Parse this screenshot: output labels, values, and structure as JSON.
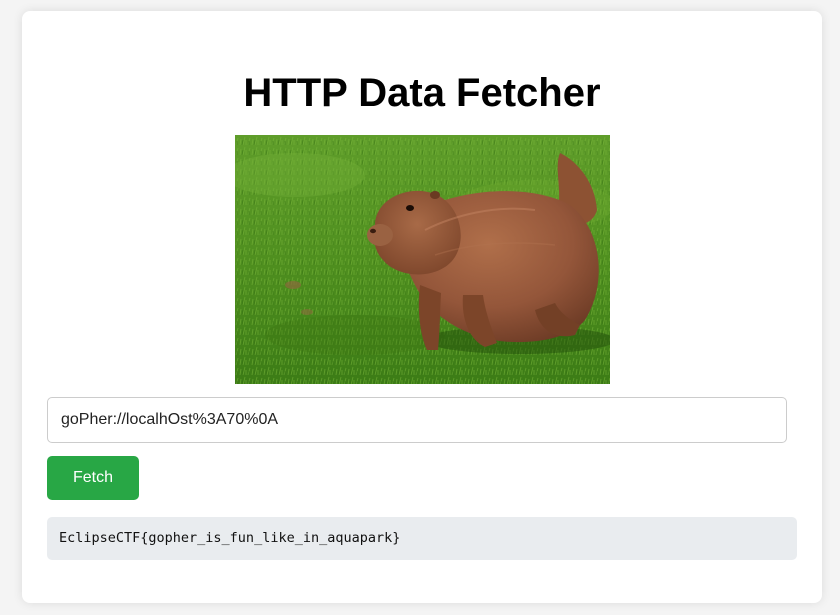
{
  "page": {
    "title": "HTTP Data Fetcher"
  },
  "hero_image": {
    "subject": "gopher-on-grass-photo"
  },
  "form": {
    "url_value": "goPher://localhOst%3A70%0A",
    "fetch_label": "Fetch"
  },
  "result": {
    "text": "EclipseCTF{gopher_is_fun_like_in_aquapark}"
  },
  "colors": {
    "page_background": "#f4f4f4",
    "card_background": "#ffffff",
    "button_green": "#28a745",
    "result_background": "#e9ecef"
  }
}
